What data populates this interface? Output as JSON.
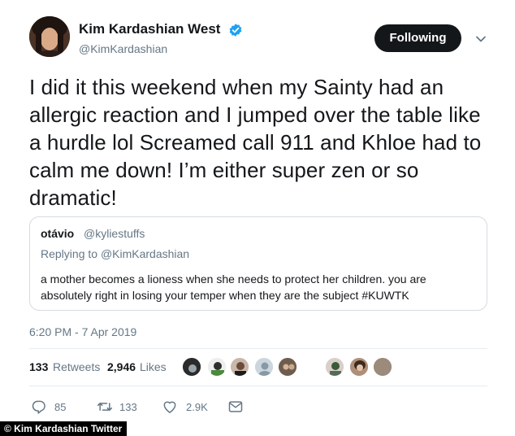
{
  "author": {
    "display_name": "Kim Kardashian West",
    "handle": "@KimKardashian",
    "follow_label": "Following"
  },
  "tweet": {
    "text": "I did it this weekend when my Sainty had an allergic reaction and I jumped over the table like a hurdle lol Screamed call 911 and Khloe had to calm me down! I’m either super zen or so dramatic!",
    "timestamp": "6:20 PM - 7 Apr 2019"
  },
  "quote": {
    "name": "otávio",
    "handle": "@kyliestuffs",
    "replying_prefix": "Replying to",
    "replying_to": "@KimKardashian",
    "text": "a mother becomes a lioness when she needs to protect her children. you are absolutely right in losing your temper when they are the subject #KUWTK"
  },
  "stats": {
    "retweets_count": "133",
    "retweets_label": "Retweets",
    "likes_count": "2,946",
    "likes_label": "Likes"
  },
  "actions": {
    "replies": "85",
    "retweets": "133",
    "likes": "2.9K"
  },
  "credit": "© Kim Kardashian Twitter",
  "icons": [
    "verified-badge-icon",
    "chevron-down-icon",
    "reply-icon",
    "retweet-icon",
    "heart-icon",
    "message-icon"
  ],
  "colors": {
    "verified": "#1da1f2",
    "text": "#14171a",
    "secondary": "#657786",
    "border": "#e6ecf0",
    "button": "#14171a"
  }
}
